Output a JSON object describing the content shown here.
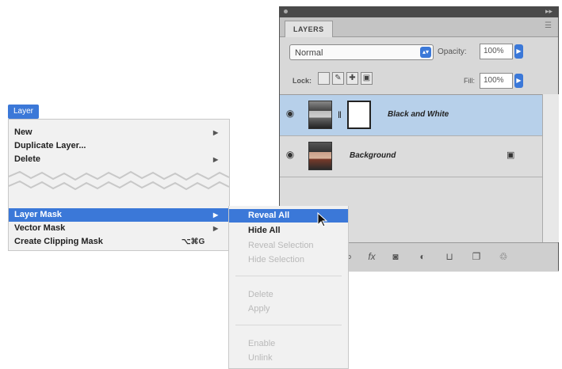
{
  "layers_panel": {
    "tab_label": "LAYERS",
    "blend_mode": "Normal",
    "opacity_label": "Opacity:",
    "opacity_value": "100%",
    "lock_label": "Lock:",
    "fill_label": "Fill:",
    "fill_value": "100%",
    "layers": [
      {
        "name": "Black and White",
        "visible": true,
        "selected": true,
        "has_mask": true,
        "locked": false
      },
      {
        "name": "Background",
        "visible": true,
        "selected": false,
        "has_mask": false,
        "locked": true
      }
    ],
    "footer_icons": [
      "link-layers-icon",
      "fx-icon",
      "add-mask-icon",
      "adjustment-icon",
      "group-folder-icon",
      "new-layer-icon",
      "trash-icon"
    ],
    "accent_color": "#3b78d8",
    "selected_row_color": "#b7d0ea"
  },
  "layer_menu": {
    "title": "Layer",
    "items": [
      {
        "label": "New",
        "submenu": true
      },
      {
        "label": "Duplicate Layer...",
        "submenu": false
      },
      {
        "label": "Delete",
        "submenu": true
      },
      {
        "label": "Layer Mask",
        "submenu": true,
        "highlighted": true
      },
      {
        "label": "Vector Mask",
        "submenu": true
      },
      {
        "label": "Create Clipping Mask",
        "shortcut": "⌥⌘G",
        "submenu": false
      }
    ]
  },
  "layer_mask_submenu": {
    "items": [
      {
        "label": "Reveal All",
        "state": "highlighted"
      },
      {
        "label": "Hide All",
        "state": "enabled"
      },
      {
        "label": "Reveal Selection",
        "state": "disabled"
      },
      {
        "label": "Hide Selection",
        "state": "disabled"
      },
      {
        "label": "Delete",
        "state": "disabled"
      },
      {
        "label": "Apply",
        "state": "disabled"
      },
      {
        "label": "Enable",
        "state": "disabled"
      },
      {
        "label": "Unlink",
        "state": "disabled"
      }
    ]
  }
}
